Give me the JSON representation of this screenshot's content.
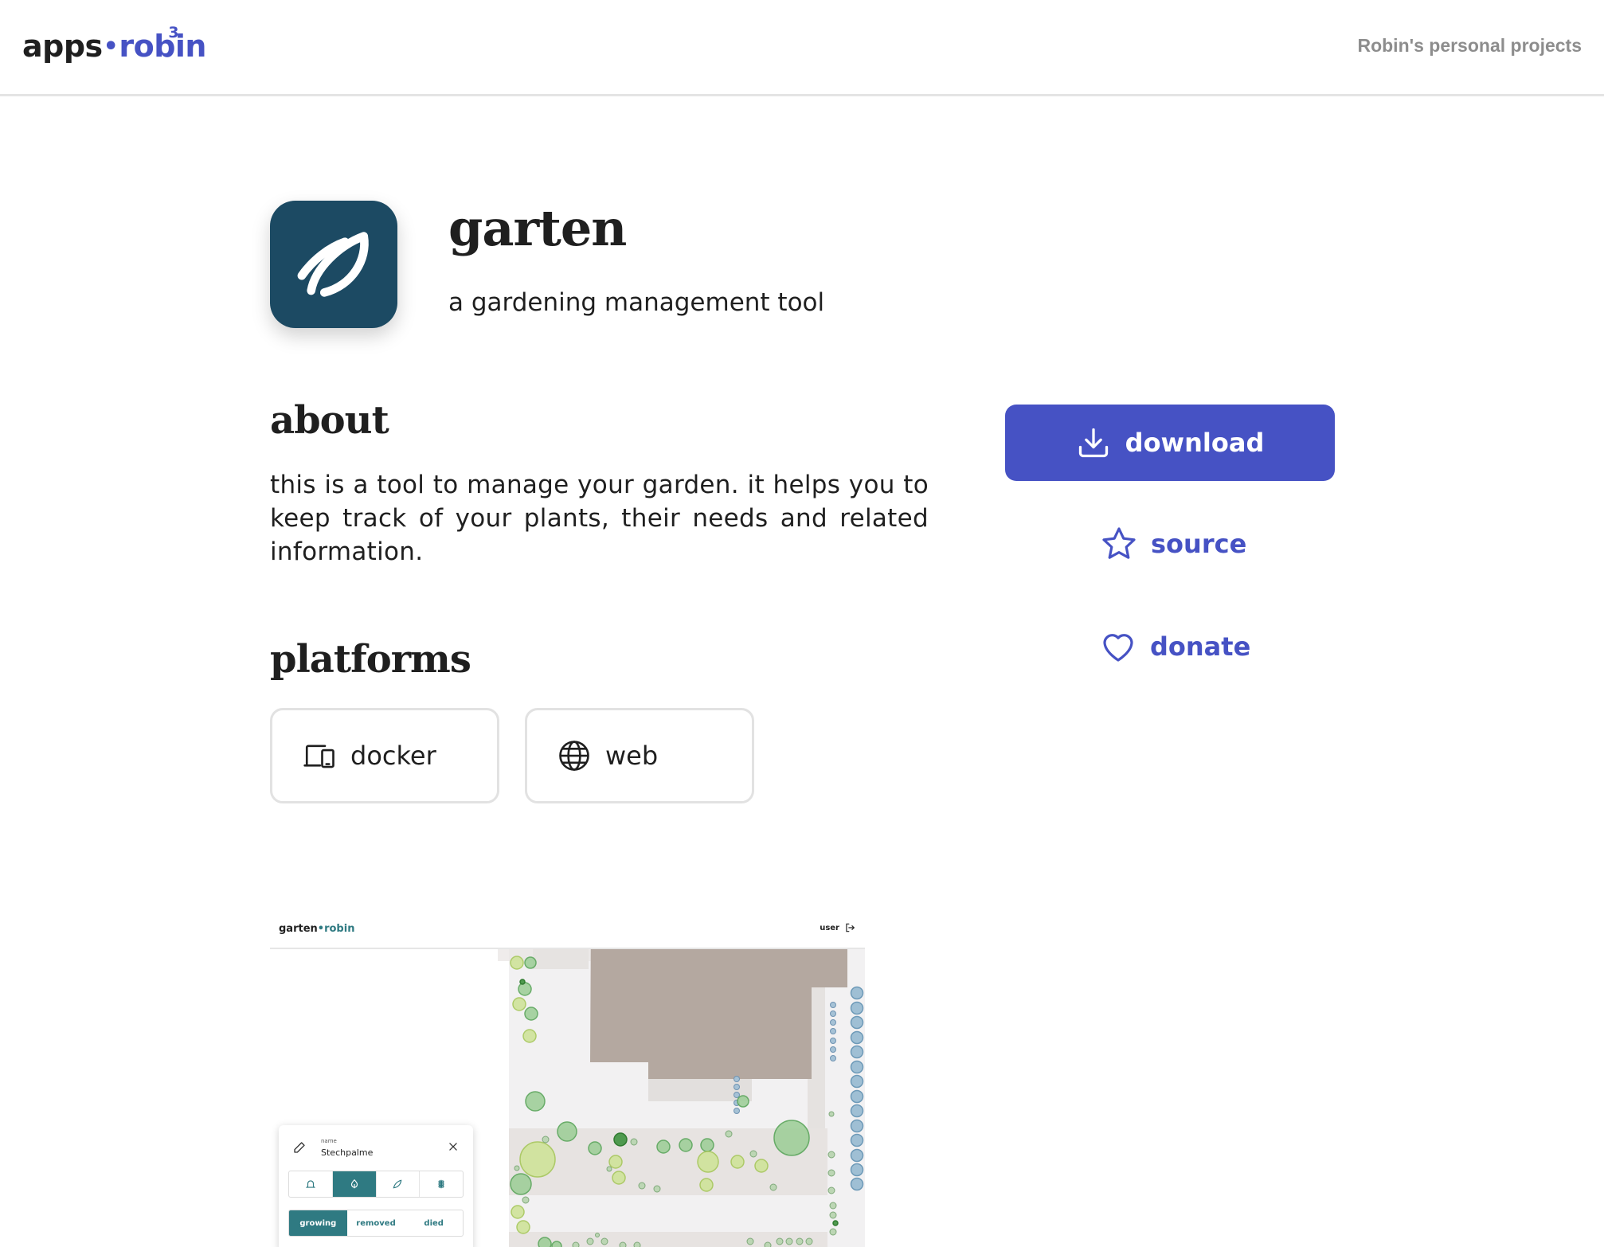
{
  "header": {
    "logo_prefix": "apps",
    "logo_dot": "•",
    "logo_name": "robin",
    "logo_superscript": "3",
    "tagline": "Robin's personal projects"
  },
  "app": {
    "icon": "leaf-icon",
    "name": "garten",
    "subtitle": "a gardening management tool"
  },
  "about": {
    "heading": "about",
    "text": "this is a tool to manage your garden. it helps you to keep track of your plants, their needs and related information."
  },
  "platforms": {
    "heading": "platforms",
    "items": [
      {
        "label": "docker",
        "icon": "devices-icon"
      },
      {
        "label": "web",
        "icon": "globe-icon"
      }
    ]
  },
  "actions": {
    "download": {
      "label": "download",
      "icon": "download-icon"
    },
    "source": {
      "label": "source",
      "icon": "star-icon"
    },
    "donate": {
      "label": "donate",
      "icon": "heart-icon"
    }
  },
  "colors": {
    "accent": "#4652c4",
    "app_icon_bg": "#1c4a63",
    "preview_accent": "#2f7a82"
  },
  "preview": {
    "logo_prefix": "garten",
    "logo_dot": "•",
    "logo_name": "robin",
    "user_label": "user",
    "panel": {
      "name_label": "name",
      "name_value": "Stechpalme",
      "status": [
        "growing",
        "removed",
        "died"
      ],
      "active_status": "growing"
    }
  }
}
